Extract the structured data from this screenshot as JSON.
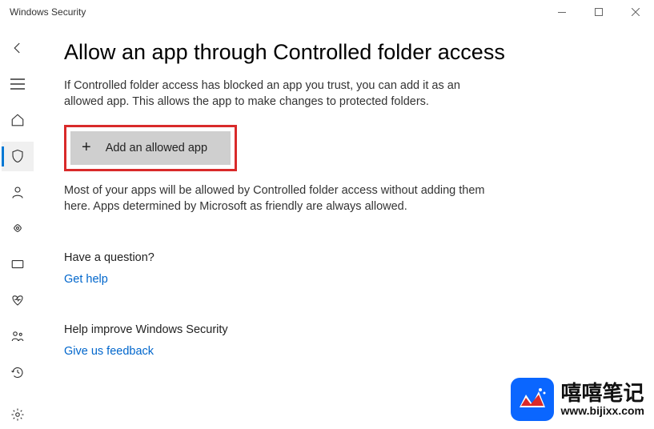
{
  "window": {
    "title": "Windows Security"
  },
  "page": {
    "heading": "Allow an app through Controlled folder access",
    "description": "If Controlled folder access has blocked an app you trust, you can add it as an allowed app. This allows the app to make changes to protected folders.",
    "add_button_label": "Add an allowed app",
    "note": "Most of your apps will be allowed by Controlled folder access without adding them here. Apps determined by Microsoft as friendly are always allowed.",
    "question_heading": "Have a question?",
    "get_help_link": "Get help",
    "feedback_heading": "Help improve Windows Security",
    "feedback_link": "Give us feedback"
  },
  "watermark": {
    "text_cn": "嘻嘻笔记",
    "url": "www.bijixx.com"
  }
}
